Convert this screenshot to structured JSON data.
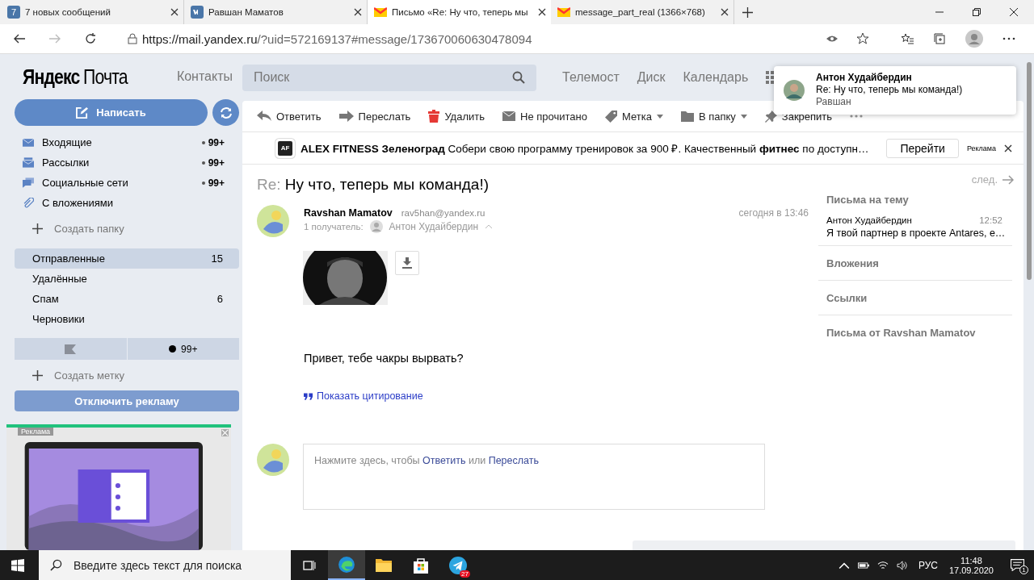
{
  "browser": {
    "tabs": [
      {
        "kind": "badge",
        "badge": "7",
        "title": "7 новых сообщений",
        "selected": false
      },
      {
        "kind": "vk",
        "title": "Равшан Маматов",
        "selected": false
      },
      {
        "kind": "mail",
        "title": "Письмо «Re: Ну что, теперь мы",
        "selected": true
      },
      {
        "kind": "mail",
        "title": "message_part_real (1366×768)",
        "selected": false
      }
    ],
    "url_host": "https://mail.yandex.ru",
    "url_path": "/?uid=572169137#message/173670060630478094"
  },
  "header": {
    "logo_brand": "Яндекс",
    "logo_product": "Почта",
    "contacts": "Контакты",
    "search_placeholder": "Поиск",
    "services": [
      "Телемост",
      "Диск",
      "Календарь"
    ]
  },
  "sidebar": {
    "compose": "Написать",
    "folders": [
      {
        "kind": "inbox",
        "name": "Входящие",
        "count": "99+"
      },
      {
        "kind": "newsletter",
        "name": "Рассылки",
        "count": "99+"
      },
      {
        "kind": "social",
        "name": "Социальные сети",
        "count": "99+"
      },
      {
        "kind": "clip",
        "name": "С вложениями"
      }
    ],
    "create_folder": "Создать папку",
    "system_folders": [
      {
        "name": "Отправленные",
        "count": "15",
        "selected": true
      },
      {
        "name": "Удалённые",
        "selected": false
      },
      {
        "name": "Спам",
        "count": "6",
        "selected": false
      },
      {
        "name": "Черновики",
        "selected": false
      }
    ],
    "unread_filter": "99+",
    "create_label": "Создать метку",
    "disable_ads": "Отключить рекламу",
    "ad": {
      "label": "Реклама",
      "kind": "picture"
    }
  },
  "toolbar": [
    {
      "kind": "reply",
      "label": "Ответить",
      "dropdown": false
    },
    {
      "kind": "forward",
      "label": "Переслать",
      "dropdown": false
    },
    {
      "kind": "trash",
      "label": "Удалить",
      "dropdown": false
    },
    {
      "kind": "envelope",
      "label": "Не прочитано",
      "dropdown": false
    },
    {
      "kind": "tag",
      "label": "Метка",
      "dropdown": true
    },
    {
      "kind": "folder",
      "label": "В папку",
      "dropdown": true
    },
    {
      "kind": "pin",
      "label": "Закрепить",
      "dropdown": false
    }
  ],
  "ad_strip": {
    "logo": "AF",
    "brand": "ALEX FITNESS Зеленоград",
    "text": "Собери свою программу тренировок за 900 ₽. Качественный **фитнес** по доступн…",
    "button": "Перейти",
    "tag": "Реклама"
  },
  "message": {
    "subject_prefix": "Re:",
    "subject": "Ну что, теперь мы команда!)",
    "next": "след.",
    "sender": "Ravshan Mamatov",
    "email": "rav5han@yandex.ru",
    "time": "сегодня в 13:46",
    "recipients_label": "1 получатель:",
    "recipient": "Антон Худайбердин",
    "body": "Привет, тебе чакры вырвать?",
    "show_quote": "Показать цитирование"
  },
  "reply_box": {
    "prefix": "Нажмите здесь, чтобы",
    "reply": "Ответить",
    "middle": "или",
    "forward": "Переслать"
  },
  "side_panel": {
    "thread_title": "Письма на тему",
    "thread": [
      {
        "from": "Антон Худайбердин",
        "time": "12:52",
        "snippet": "Я твой партнер в проекте Antares, е…"
      }
    ],
    "sections": [
      "Вложения",
      "Ссылки",
      "Письма от Ravshan Mamatov"
    ]
  },
  "notification": {
    "name": "Антон Худайбердин",
    "subject": "Re: Ну что, теперь мы команда!)",
    "text": "Равшан"
  },
  "taskbar": {
    "search_placeholder": "Введите здесь текст для поиска",
    "apps": [
      {
        "kind": "taskview",
        "selected": false
      },
      {
        "kind": "edge",
        "selected": true
      },
      {
        "kind": "explorer",
        "selected": false
      },
      {
        "kind": "store",
        "selected": false
      },
      {
        "kind": "telegram",
        "selected": false,
        "badge": "27"
      }
    ],
    "language": "РУС",
    "time": "11:48",
    "date": "17.09.2020",
    "notifications": "1"
  }
}
